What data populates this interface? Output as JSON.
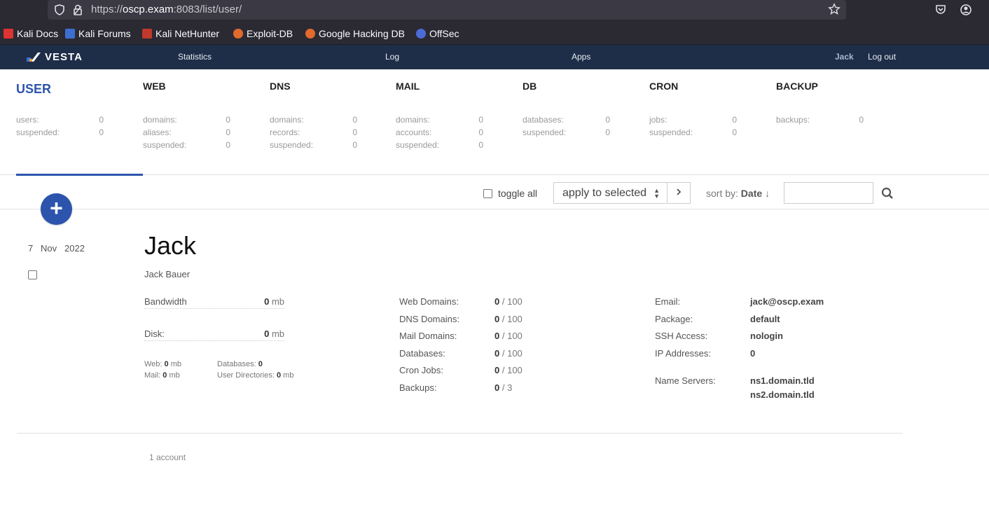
{
  "browser": {
    "url_prefix": "https://",
    "url_host": "oscp.exam",
    "url_rest": ":8083/list/user/",
    "bookmarks": [
      "Kali Docs",
      "Kali Forums",
      "Kali NetHunter",
      "Exploit-DB",
      "Google Hacking DB",
      "OffSec"
    ]
  },
  "nav": {
    "logo": "VESTA",
    "statistics": "Statistics",
    "log": "Log",
    "apps": "Apps",
    "user": "Jack",
    "logout": "Log out"
  },
  "stats": [
    {
      "title": "USER",
      "rows": [
        {
          "label": "users:",
          "value": "0"
        },
        {
          "label": "suspended:",
          "value": "0"
        }
      ]
    },
    {
      "title": "WEB",
      "rows": [
        {
          "label": "domains:",
          "value": "0"
        },
        {
          "label": "aliases:",
          "value": "0"
        },
        {
          "label": "suspended:",
          "value": "0"
        }
      ]
    },
    {
      "title": "DNS",
      "rows": [
        {
          "label": "domains:",
          "value": "0"
        },
        {
          "label": "records:",
          "value": "0"
        },
        {
          "label": "suspended:",
          "value": "0"
        }
      ]
    },
    {
      "title": "MAIL",
      "rows": [
        {
          "label": "domains:",
          "value": "0"
        },
        {
          "label": "accounts:",
          "value": "0"
        },
        {
          "label": "suspended:",
          "value": "0"
        }
      ]
    },
    {
      "title": "DB",
      "rows": [
        {
          "label": "databases:",
          "value": "0"
        },
        {
          "label": "suspended:",
          "value": "0"
        }
      ]
    },
    {
      "title": "CRON",
      "rows": [
        {
          "label": "jobs:",
          "value": "0"
        },
        {
          "label": "suspended:",
          "value": "0"
        }
      ]
    },
    {
      "title": "BACKUP",
      "rows": [
        {
          "label": "backups:",
          "value": "0"
        }
      ]
    }
  ],
  "toolbar": {
    "add": "+",
    "toggle_all": "toggle all",
    "apply": "apply to selected",
    "sort_prefix": "sort by:",
    "sort_field": "Date",
    "sort_dir": "↓"
  },
  "user": {
    "day": "7",
    "month": "Nov",
    "year": "2022",
    "username": "Jack",
    "fullname": "Jack Bauer",
    "bandwidth_label": "Bandwidth",
    "bandwidth_value": "0",
    "disk_label": "Disk:",
    "disk_value": "0",
    "unit": "mb",
    "web_label": "Web:",
    "web_value": "0",
    "mail_label": "Mail:",
    "mail_value": "0",
    "databases_label": "Databases:",
    "databases_value": "0",
    "userdirs_label": "User Directories:",
    "userdirs_value": "0",
    "limits": [
      {
        "label": "Web Domains:",
        "used": "0",
        "max": "/ 100"
      },
      {
        "label": "DNS Domains:",
        "used": "0",
        "max": "/ 100"
      },
      {
        "label": "Mail Domains:",
        "used": "0",
        "max": "/ 100"
      },
      {
        "label": "Databases:",
        "used": "0",
        "max": "/ 100"
      },
      {
        "label": "Cron Jobs:",
        "used": "0",
        "max": "/ 100"
      },
      {
        "label": "Backups:",
        "used": "0",
        "max": "/ 3"
      }
    ],
    "info": [
      {
        "label": "Email:",
        "value": "jack@oscp.exam"
      },
      {
        "label": "Package:",
        "value": "default"
      },
      {
        "label": "SSH Access:",
        "value": "nologin"
      },
      {
        "label": "IP Addresses:",
        "value": "0"
      }
    ],
    "ns_label": "Name Servers:",
    "ns1": "ns1.domain.tld",
    "ns2": "ns2.domain.tld"
  },
  "footer": {
    "count": "1 account"
  },
  "colors": {
    "accent": "#2c54ac",
    "nav_bg": "#1e2d48",
    "chrome_bg": "#2b2a33"
  }
}
